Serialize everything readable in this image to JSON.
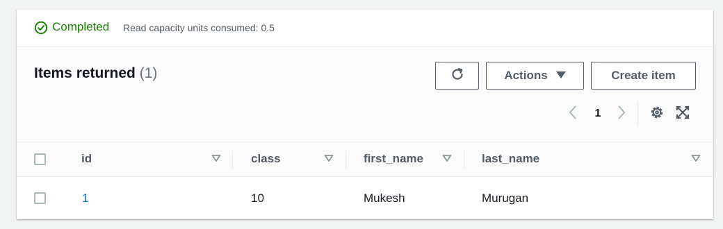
{
  "status": {
    "state": "Completed",
    "meta": "Read capacity units consumed: 0.5",
    "icon": "check-circle-icon",
    "color": "#1d8102"
  },
  "header": {
    "title": "Items returned",
    "count": "(1)",
    "refresh_icon": "refresh-icon",
    "actions_label": "Actions",
    "create_label": "Create item"
  },
  "pagination": {
    "current_page": "1",
    "prev_icon": "chevron-left-icon",
    "next_icon": "chevron-right-icon",
    "settings_icon": "gear-icon",
    "expand_icon": "expand-icon"
  },
  "table": {
    "columns": [
      "id",
      "class",
      "first_name",
      "last_name"
    ],
    "rows": [
      {
        "id": "1",
        "class": "10",
        "first_name": "Mukesh",
        "last_name": "Murugan"
      }
    ],
    "link_color": "#0073bb"
  }
}
